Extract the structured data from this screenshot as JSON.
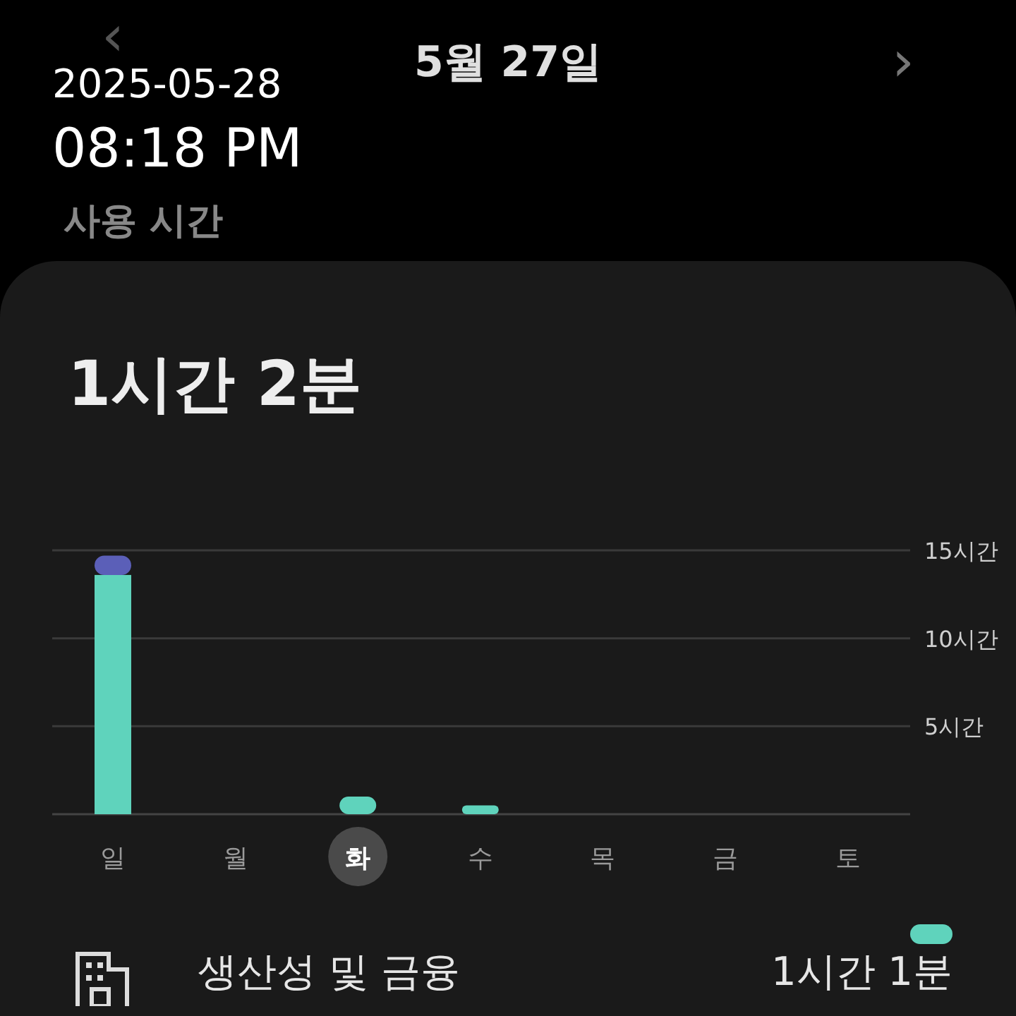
{
  "overlay_timestamp": {
    "date": "2025-05-28",
    "time": "08:18 PM"
  },
  "header": {
    "title": "5월 27일",
    "prev": "‹",
    "next": "›"
  },
  "section_label": "사용 시간",
  "card": {
    "total": "1시간 2분",
    "chart_data": {
      "type": "bar",
      "stacked": true,
      "categories": [
        "일",
        "월",
        "화",
        "수",
        "목",
        "금",
        "토"
      ],
      "series": [
        {
          "color": "#5fd3bc",
          "values": [
            13.6,
            0,
            1.0,
            0.5,
            0,
            0,
            0
          ]
        },
        {
          "color": "#5b5fb8",
          "values": [
            1.1,
            0,
            0,
            0,
            0,
            0,
            0
          ]
        }
      ],
      "ylim": [
        0,
        15
      ],
      "yticks": [
        {
          "value": 5,
          "label": "5시간"
        },
        {
          "value": 10,
          "label": "10시간"
        },
        {
          "value": 15,
          "label": "15시간"
        }
      ]
    },
    "days": [
      {
        "selected": false
      },
      {
        "selected": false
      },
      {
        "selected": true
      },
      {
        "selected": false
      },
      {
        "selected": false
      },
      {
        "selected": false
      },
      {
        "selected": false
      }
    ],
    "categories": [
      {
        "name": "생산성 및 금융",
        "duration": "1시간 1분",
        "color": "#5fd3bc"
      }
    ]
  }
}
